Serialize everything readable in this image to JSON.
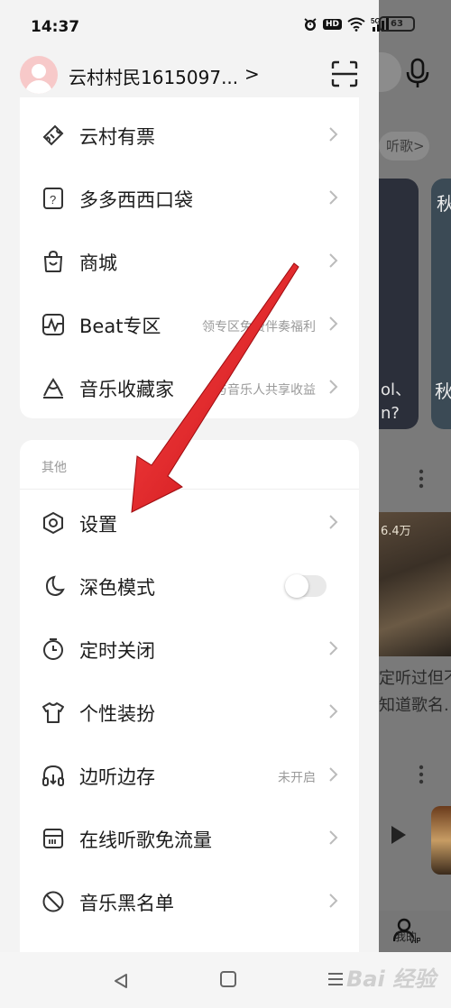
{
  "status_bar": {
    "time": "14:37",
    "hd_badge": "HD",
    "network_label": "5G",
    "battery_level": "63"
  },
  "header": {
    "username": "云村村民1615097...",
    "chevron": ">"
  },
  "background_app": {
    "tag_text": "听歌>",
    "card1_text": "ol、\nn?",
    "card2_char": "秋",
    "card2_char2": "秋",
    "photo_count": "6.4万",
    "caption": "定听过但不\n知道歌名.",
    "tab_me_label": "我的",
    "vip_badge": "VIP"
  },
  "top_card": {
    "items": [
      {
        "label": "云村有票",
        "sub": "",
        "icon": "ticket-icon"
      },
      {
        "label": "多多西西口袋",
        "sub": "",
        "icon": "pocket-icon"
      },
      {
        "label": "商城",
        "sub": "",
        "icon": "shopping-bag-icon"
      },
      {
        "label": "Beat专区",
        "sub": "领专区免费伴奏福利",
        "icon": "beat-wave-icon"
      },
      {
        "label": "音乐收藏家",
        "sub": "与音乐人共享收益",
        "icon": "collector-icon"
      }
    ]
  },
  "other_card": {
    "section_title": "其他",
    "items": [
      {
        "label": "设置",
        "sub": "",
        "icon": "settings-hexagon-icon"
      },
      {
        "label": "深色模式",
        "sub": "",
        "icon": "moon-icon",
        "toggle": false
      },
      {
        "label": "定时关闭",
        "sub": "",
        "icon": "timer-icon"
      },
      {
        "label": "个性装扮",
        "sub": "",
        "icon": "tshirt-icon"
      },
      {
        "label": "边听边存",
        "sub": "未开启",
        "icon": "headphones-icon"
      },
      {
        "label": "在线听歌免流量",
        "sub": "",
        "icon": "sim-card-icon"
      },
      {
        "label": "音乐黑名单",
        "sub": "",
        "icon": "block-icon"
      }
    ]
  },
  "watermark": "Bai 经验",
  "colors": {
    "accent_arrow": "#e0151b",
    "card_bg": "#ffffff",
    "page_bg": "#f3f3f3"
  }
}
